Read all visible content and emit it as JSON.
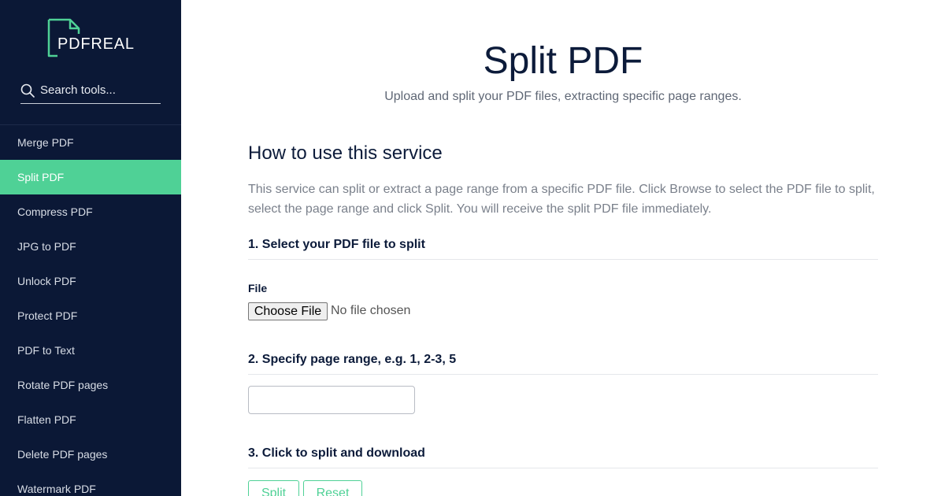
{
  "brand": {
    "name": "PDFREAL",
    "accent": "#4fd196",
    "sidebar_bg": "#0b1836"
  },
  "search": {
    "placeholder": "Search tools..."
  },
  "sidebar": {
    "items": [
      {
        "label": "Merge PDF"
      },
      {
        "label": "Split PDF",
        "active": true
      },
      {
        "label": "Compress PDF"
      },
      {
        "label": "JPG to PDF"
      },
      {
        "label": "Unlock PDF"
      },
      {
        "label": "Protect PDF"
      },
      {
        "label": "PDF to Text"
      },
      {
        "label": "Rotate PDF pages"
      },
      {
        "label": "Flatten PDF"
      },
      {
        "label": "Delete PDF pages"
      },
      {
        "label": "Watermark PDF"
      }
    ]
  },
  "main": {
    "title": "Split PDF",
    "subtitle": "Upload and split your PDF files, extracting specific page ranges.",
    "howto_title": "How to use this service",
    "howto_text": "This service can split or extract a page range from a specific PDF file. Click Browse to select the PDF file to split, select the page range and click Split. You will receive the split PDF file immediately.",
    "step1": "1. Select your PDF file to split",
    "file_label": "File",
    "file_button": "Choose File",
    "file_status": "No file chosen",
    "step2": "2. Specify page range, e.g. 1, 2-3, 5",
    "range_value": "",
    "step3": "3. Click to split and download",
    "split_button": "Split",
    "reset_button": "Reset"
  }
}
